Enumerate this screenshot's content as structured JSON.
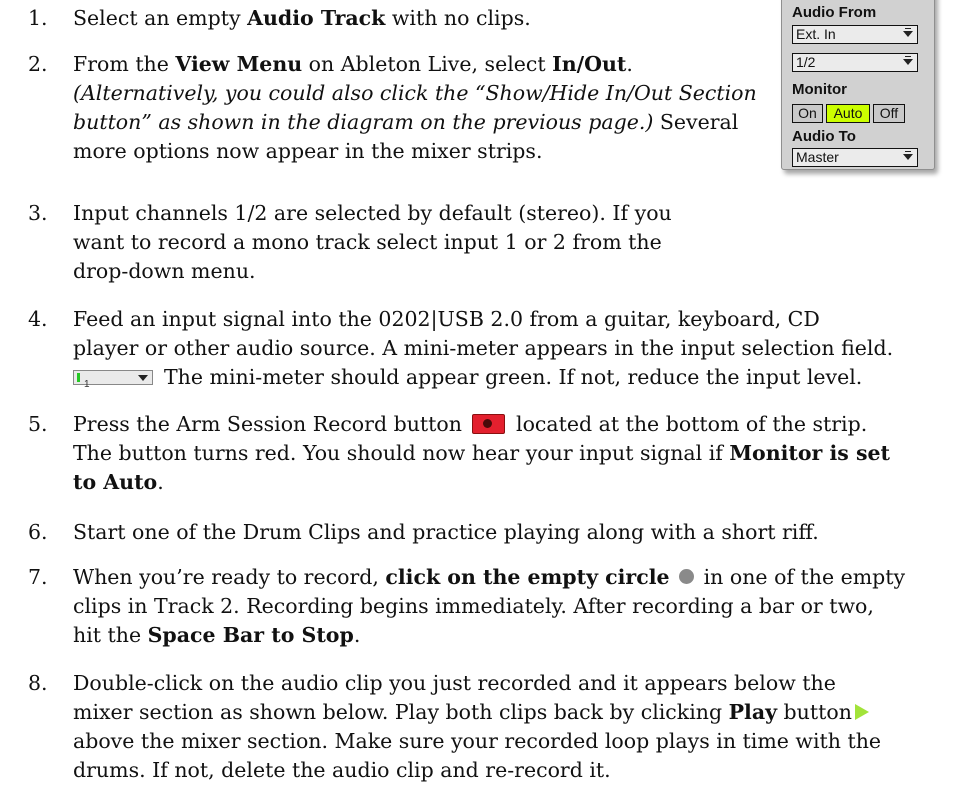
{
  "steps": [
    {
      "num": "1.",
      "lines": [
        [
          "Select an empty ",
          "Audio Track",
          " with no clips."
        ]
      ]
    },
    {
      "num": "2.",
      "l1a": "From the ",
      "l1b": "View Menu",
      "l1c": " on Ableton Live, select ",
      "l1d": "In/Out",
      "l1e": ".",
      "l2": "(Alternatively, you could also click the “Show/Hide In/Out Section",
      "l3a": "button” as shown in the diagram on the previous page.)",
      "l3b": " Several",
      "l4": "more options now appear in the mixer strips."
    },
    {
      "num": "3.",
      "l1": "Input channels 1/2 are selected by default (stereo). If you",
      "l2": "want to record a mono track select input 1 or 2 from the",
      "l3": "drop-down menu."
    },
    {
      "num": "4.",
      "l1": "Feed an input signal into the 0202|USB 2.0 from a guitar, keyboard, CD",
      "l2": "player or other audio source. A mini-meter appears in the input selection field.",
      "l3": "The mini-meter should appear green. If not, reduce the input level."
    },
    {
      "num": "5.",
      "l1a": "Press the Arm Session Record button",
      "l1b": "located at the bottom of the strip.",
      "l2a": "The button turns red. You should now hear your input signal if ",
      "l2b": "Monitor is set",
      "l3a": "to Auto",
      "l3b": "."
    },
    {
      "num": "6.",
      "l1": "Start one of the Drum Clips and practice playing along with a short riff."
    },
    {
      "num": "7.",
      "l1a": "When you’re ready to record, ",
      "l1b": "click on the empty circle",
      "l1c": "in one of the empty",
      "l2": "clips in Track 2. Recording begins immediately. After recording a bar or two,",
      "l3a": "hit the ",
      "l3b": "Space Bar to Stop",
      "l3c": "."
    },
    {
      "num": "8.",
      "l1": "Double-click on the audio clip you just recorded and it appears below the",
      "l2a": "mixer section as shown below. Play both clips back by clicking ",
      "l2b": "Play",
      "l2c": " button",
      "l3": "above the mixer section. Make sure your recorded loop plays in time with the",
      "l4": "drums. If not, delete the audio clip and re-record it."
    }
  ],
  "mini_meter_text": "1",
  "panel": {
    "audio_from_label": "Audio From",
    "audio_from_value": "Ext. In",
    "channel_value": "1/2",
    "monitor_label": "Monitor",
    "monitor_options": [
      "On",
      "Auto",
      "Off"
    ],
    "monitor_selected": "Auto",
    "audio_to_label": "Audio To",
    "audio_to_value": "Master"
  },
  "colors": {
    "monitor_selected": "#ccff00",
    "arm_button": "#e3202e",
    "play_button": "#a2e33a",
    "meter_green": "#26c826"
  }
}
